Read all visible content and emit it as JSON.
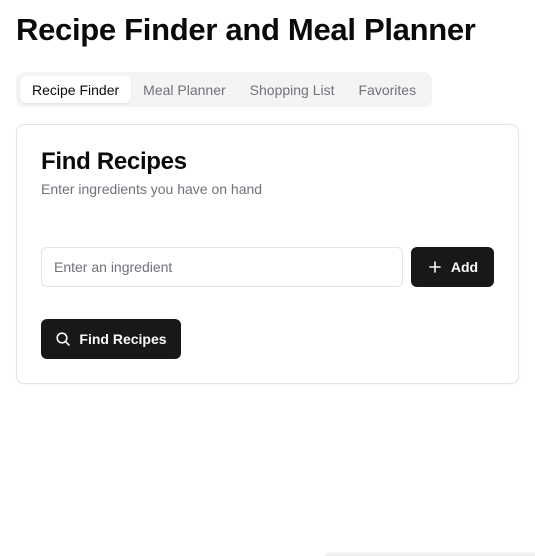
{
  "page": {
    "title": "Recipe Finder and Meal Planner"
  },
  "tabs": [
    {
      "label": "Recipe Finder",
      "active": true
    },
    {
      "label": "Meal Planner",
      "active": false
    },
    {
      "label": "Shopping List",
      "active": false
    },
    {
      "label": "Favorites",
      "active": false
    }
  ],
  "finder": {
    "title": "Find Recipes",
    "description": "Enter ingredients you have on hand",
    "input": {
      "value": "",
      "placeholder": "Enter an ingredient"
    },
    "add_button": {
      "label": "Add",
      "icon": "plus-icon"
    },
    "find_button": {
      "label": "Find Recipes",
      "icon": "search-icon"
    }
  },
  "colors": {
    "primary": "#18181b",
    "muted_text": "#71717a",
    "border": "#e4e4e7",
    "tab_bg": "#f4f4f5"
  }
}
